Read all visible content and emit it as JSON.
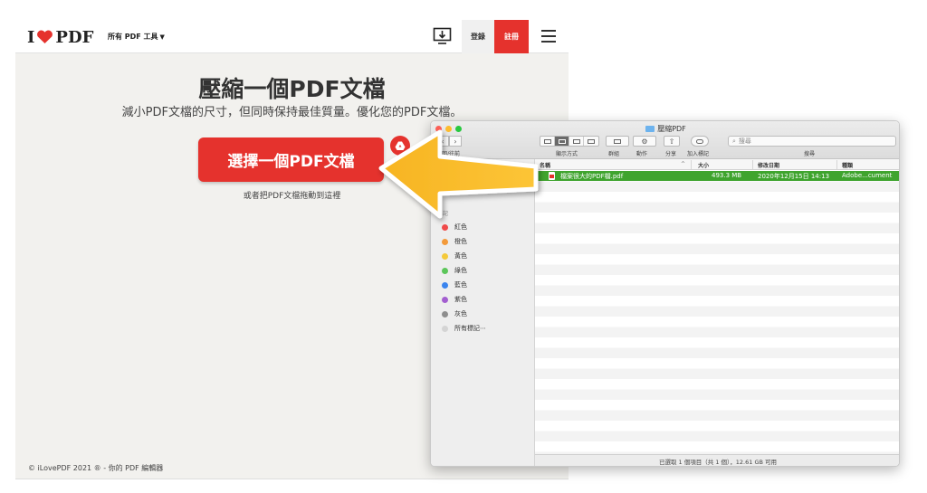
{
  "ilovepdf": {
    "logo": {
      "left": "I",
      "right": "PDF"
    },
    "tools_menu": "所有 PDF 工具",
    "login": "登錄",
    "signup": "註冊",
    "title": "壓縮一個PDF文檔",
    "subtitle": "減小PDF文檔的尺寸，但同時保持最佳質量。優化您的PDF文檔。",
    "select_button": "選擇一個PDF文檔",
    "drop_hint": "或者把PDF文檔拖動到這裡",
    "footer": "© iLovePDF 2021 ® - 你的 PDF 編輯器",
    "accent": "#e5322d"
  },
  "finder": {
    "window_title": "壓縮PDF",
    "toolbar_labels": {
      "back_forward": "返回/往前",
      "view": "顯示方式",
      "group": "群組",
      "action": "動作",
      "share": "分享",
      "tags": "加入標記",
      "search": "搜尋"
    },
    "search_placeholder": "搜尋",
    "sidebar": {
      "tags_header": "標記",
      "tags": [
        {
          "name": "紅色",
          "color": "#f04a4a"
        },
        {
          "name": "橙色",
          "color": "#f39a3a"
        },
        {
          "name": "黃色",
          "color": "#f4c93a"
        },
        {
          "name": "綠色",
          "color": "#5cc65a"
        },
        {
          "name": "藍色",
          "color": "#3a84ee"
        },
        {
          "name": "紫色",
          "color": "#a35fd0"
        },
        {
          "name": "灰色",
          "color": "#8e8e8e"
        },
        {
          "name": "所有標記⋯",
          "color": "#d4d4d4"
        }
      ]
    },
    "columns": {
      "name": "名稱",
      "size": "大小",
      "date": "修改日期",
      "kind": "種類"
    },
    "files": [
      {
        "name": "檔案很大的PDF檔.pdf",
        "size": "493.3 MB",
        "date": "2020年12月15日 14:13",
        "kind": "Adobe...cument"
      }
    ],
    "status": "已選取 1 個項目（共 1 個），12.61 GB 可用",
    "selection_color": "#3fa42e"
  }
}
